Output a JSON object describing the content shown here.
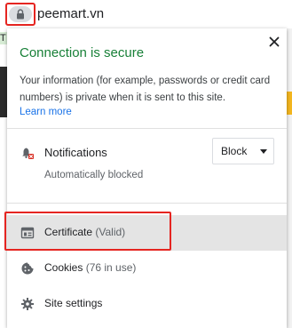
{
  "addressbar": {
    "url": "peemart.vn",
    "lock_icon": "lock-icon"
  },
  "page": {
    "left_letter": "T"
  },
  "popup": {
    "title": "Connection is secure",
    "description": "Your information (for example, passwords or credit card numbers) is private when it is sent to this site.",
    "learn_more": "Learn more",
    "close_icon": "close-icon",
    "notifications": {
      "label": "Notifications",
      "sublabel": "Automatically blocked",
      "select_value": "Block",
      "icon": "bell-blocked-icon"
    },
    "items": [
      {
        "label": "Certificate",
        "extra": "(Valid)",
        "icon": "certificate-icon"
      },
      {
        "label": "Cookies",
        "extra": "(76 in use)",
        "icon": "cookie-icon"
      },
      {
        "label": "Site settings",
        "extra": "",
        "icon": "gear-icon"
      }
    ]
  },
  "colors": {
    "secure_green": "#188038",
    "link_blue": "#1a73e8",
    "highlight_red": "#e52521",
    "row_highlight": "#e4e4e4"
  }
}
